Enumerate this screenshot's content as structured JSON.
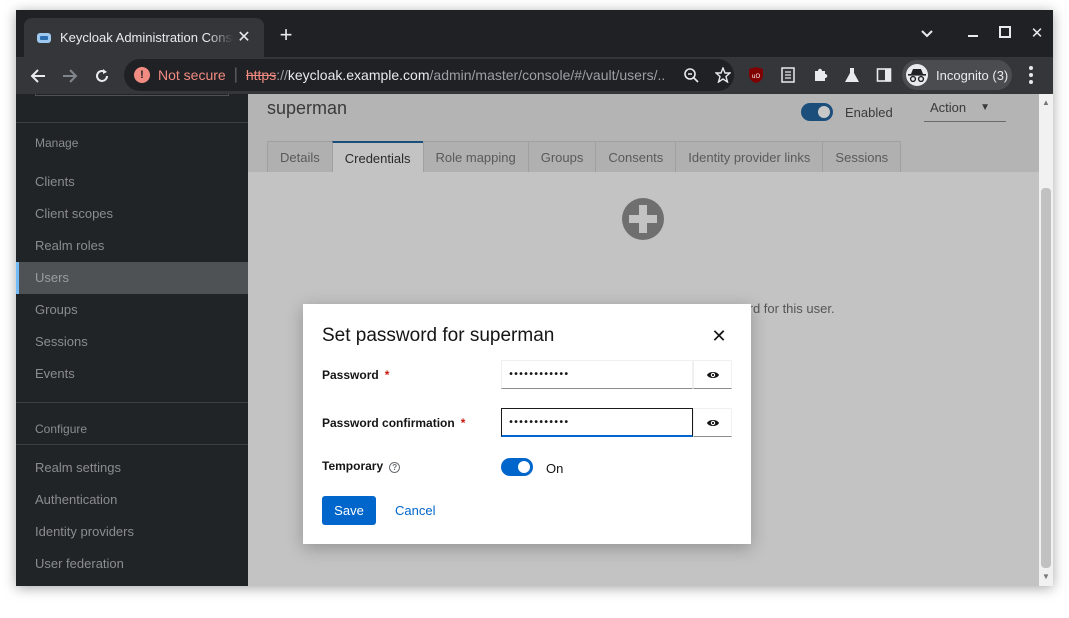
{
  "browser": {
    "tab_title": "Keycloak Administration Console",
    "not_secure_label": "Not secure",
    "url_scheme": "https",
    "url_sep": "://",
    "url_host": "keycloak.example.com",
    "url_path": "/admin/master/console/#/vault/users/...",
    "incognito_label": "Incognito (3)"
  },
  "sidebar": {
    "manage_label": "Manage",
    "manage_items": [
      "Clients",
      "Client scopes",
      "Realm roles",
      "Users",
      "Groups",
      "Sessions",
      "Events"
    ],
    "active_item": "Users",
    "configure_label": "Configure",
    "configure_items": [
      "Realm settings",
      "Authentication",
      "Identity providers",
      "User federation"
    ]
  },
  "header": {
    "user_title": "superman",
    "enabled_label": "Enabled",
    "action_label": "Action"
  },
  "tabs": [
    "Details",
    "Credentials",
    "Role mapping",
    "Groups",
    "Consents",
    "Identity provider links",
    "Sessions"
  ],
  "active_tab": "Credentials",
  "empty_state": {
    "text": "word for this user."
  },
  "modal": {
    "title": "Set password for superman",
    "password_label": "Password",
    "password_value": "••••••••••••",
    "confirm_label": "Password confirmation",
    "confirm_value": "••••••••••••",
    "required_mark": "*",
    "temporary_label": "Temporary",
    "help_glyph": "?",
    "toggle_label": "On",
    "save_label": "Save",
    "cancel_label": "Cancel"
  }
}
